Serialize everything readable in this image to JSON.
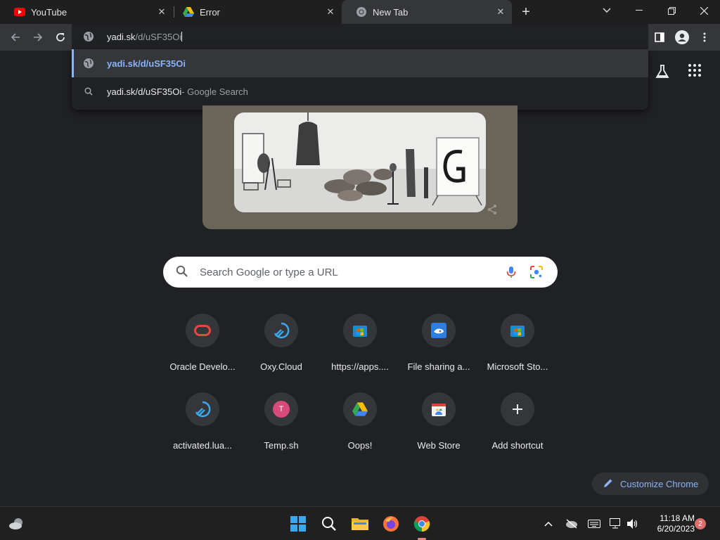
{
  "tabs": [
    {
      "title": "YouTube",
      "icon": "youtube-icon",
      "active": false
    },
    {
      "title": "Error",
      "icon": "google-drive-icon",
      "active": false
    },
    {
      "title": "New Tab",
      "icon": "chrome-icon",
      "active": true
    }
  ],
  "omnibox": {
    "typed": "yadi.sk",
    "autocomplete": "/d/uSF35Oi"
  },
  "suggestions": [
    {
      "text": "yadi.sk/d/uSF35Oi",
      "suffix": "",
      "icon": "globe-icon"
    },
    {
      "text": "yadi.sk/d/uSF35Oi",
      "suffix": " - Google Search",
      "icon": "search-icon"
    }
  ],
  "search": {
    "placeholder": "Search Google or type a URL"
  },
  "shortcuts": [
    {
      "label": "Oracle Develo...",
      "icon": "oracle-icon"
    },
    {
      "label": "Oxy.Cloud",
      "icon": "oxy-cloud-icon"
    },
    {
      "label": "https://apps....",
      "icon": "microsoft-store-icon"
    },
    {
      "label": "File sharing a...",
      "icon": "file-sharing-icon"
    },
    {
      "label": "Microsoft Sto...",
      "icon": "microsoft-store-icon"
    },
    {
      "label": "activated.lua...",
      "icon": "oxy-cloud-icon"
    },
    {
      "label": "Temp.sh",
      "icon": "letter-avatar-icon",
      "letter": "T"
    },
    {
      "label": "Oops!",
      "icon": "google-drive-icon"
    },
    {
      "label": "Web Store",
      "icon": "web-store-icon"
    },
    {
      "label": "Add shortcut",
      "icon": "plus-icon"
    }
  ],
  "customize": {
    "label": "Customize Chrome"
  },
  "taskbar": {
    "time": "11:18 AM",
    "date": "6/20/2023",
    "notifications": "2"
  },
  "colors": {
    "accent": "#8ab4f8",
    "background": "#202124",
    "toolbar": "#35363a"
  }
}
